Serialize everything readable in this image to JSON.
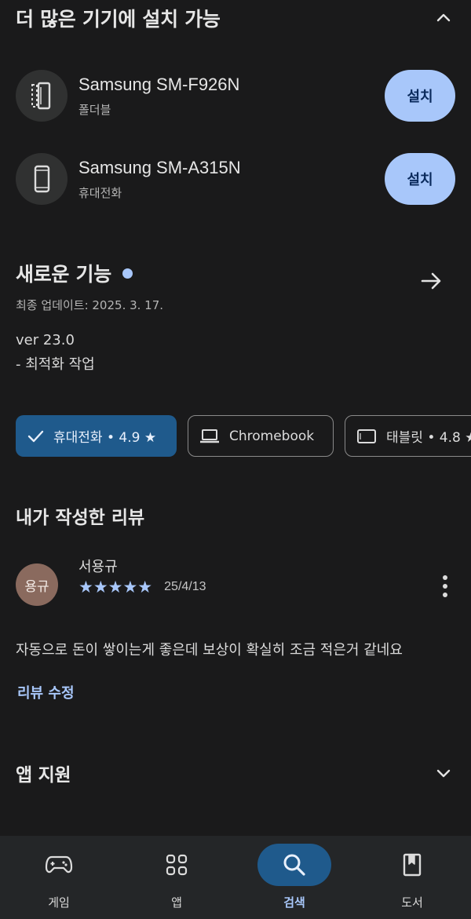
{
  "more_devices": {
    "title": "더 많은 기기에 설치 가능",
    "devices": [
      {
        "name": "Samsung SM-F926N",
        "type": "폴더블",
        "icon": "foldable-icon",
        "action": "설치"
      },
      {
        "name": "Samsung SM-A315N",
        "type": "휴대전화",
        "icon": "phone-icon",
        "action": "설치"
      }
    ]
  },
  "whats_new": {
    "title": "새로운 기능",
    "updated": "최종 업데이트: 2025. 3. 17.",
    "notes": [
      "ver 23.0",
      "- 최적화 작업"
    ]
  },
  "device_chips": [
    {
      "label": "휴대전화 • 4.9 ★",
      "icon": "check-icon",
      "selected": true
    },
    {
      "label": "Chromebook",
      "icon": "laptop-icon",
      "selected": false
    },
    {
      "label": "태블릿 • 4.8 ★",
      "icon": "tablet-icon",
      "selected": false
    }
  ],
  "my_review": {
    "title": "내가 작성한 리뷰",
    "avatar_text": "용규",
    "reviewer_name": "서용규",
    "rating": 5,
    "stars": "★★★★★",
    "date": "25/4/13",
    "text": "자동으로 돈이 쌓이는게 좋은데 보상이 확실히 조금 적은거 같네요",
    "edit_label": "리뷰 수정"
  },
  "app_support": {
    "title": "앱 지원"
  },
  "bottom_nav": [
    {
      "label": "게임",
      "icon": "gamepad-icon",
      "active": false
    },
    {
      "label": "앱",
      "icon": "apps-grid-icon",
      "active": false
    },
    {
      "label": "검색",
      "icon": "search-icon",
      "active": true
    },
    {
      "label": "도서",
      "icon": "book-icon",
      "active": false
    }
  ],
  "colors": {
    "background": "#1a1a1b",
    "accent": "#a8c7fa",
    "selected_chip": "#1f5a8c",
    "install_button": "#a8c7fa"
  }
}
